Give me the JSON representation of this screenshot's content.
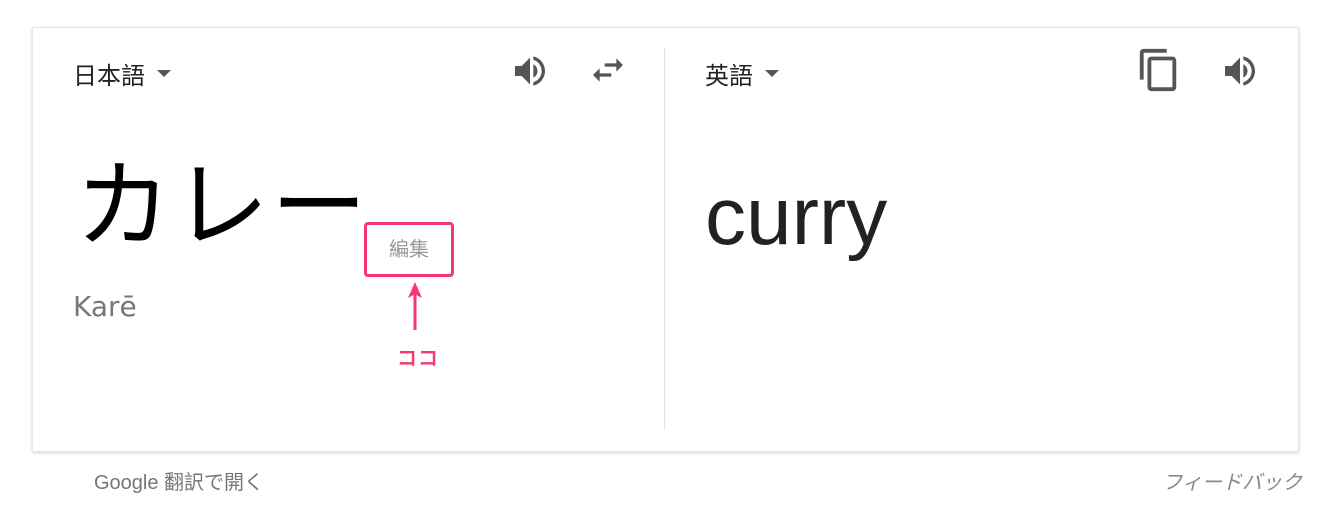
{
  "source": {
    "language_label": "日本語",
    "text": "カレー",
    "romanization": "Karē",
    "edit_label": "編集",
    "icons": [
      "speaker-icon",
      "swap-icon"
    ]
  },
  "target": {
    "language_label": "英語",
    "text": "curry",
    "icons": [
      "copy-icon",
      "speaker-icon"
    ]
  },
  "annotation": {
    "label": "ココ",
    "color": "#f5386f"
  },
  "footer": {
    "open_link": "Google 翻訳で開く",
    "feedback_link": "フィードバック"
  }
}
